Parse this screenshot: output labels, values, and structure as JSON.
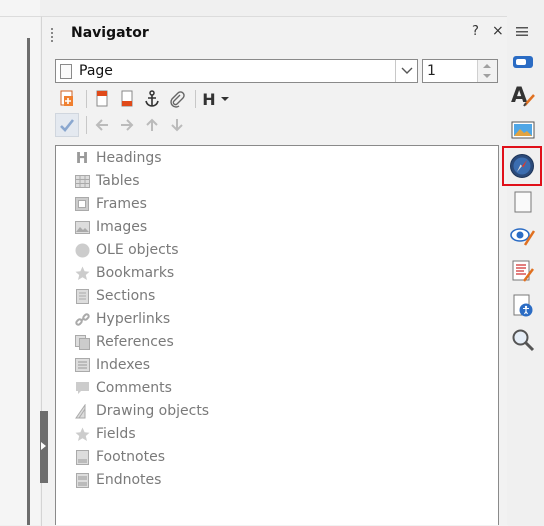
{
  "navigator": {
    "title": "Navigator",
    "help_label": "?",
    "close_label": "×",
    "navigate_by": "Page",
    "page_number": "1",
    "categories": [
      {
        "label": "Headings",
        "icon": "headings-icon"
      },
      {
        "label": "Tables",
        "icon": "tables-icon"
      },
      {
        "label": "Frames",
        "icon": "frames-icon"
      },
      {
        "label": "Images",
        "icon": "images-icon"
      },
      {
        "label": "OLE objects",
        "icon": "ole-objects-icon"
      },
      {
        "label": "Bookmarks",
        "icon": "bookmarks-icon"
      },
      {
        "label": "Sections",
        "icon": "sections-icon"
      },
      {
        "label": "Hyperlinks",
        "icon": "hyperlinks-icon"
      },
      {
        "label": "References",
        "icon": "references-icon"
      },
      {
        "label": "Indexes",
        "icon": "indexes-icon"
      },
      {
        "label": "Comments",
        "icon": "comments-icon"
      },
      {
        "label": "Drawing objects",
        "icon": "drawing-objects-icon"
      },
      {
        "label": "Fields",
        "icon": "fields-icon"
      },
      {
        "label": "Footnotes",
        "icon": "footnotes-icon"
      },
      {
        "label": "Endnotes",
        "icon": "endnotes-icon"
      }
    ],
    "heading_toolbar_label": "H"
  },
  "sidebar": {
    "tabs": [
      "properties-icon",
      "styles-icon",
      "gallery-icon",
      "navigator-icon",
      "page-icon",
      "style-inspector-icon",
      "manage-changes-icon",
      "accessibility-check-icon",
      "find-replace-icon"
    ],
    "active": "navigator-icon"
  },
  "colors": {
    "selection_border": "#e0101a",
    "item_text": "#7a7a7a",
    "accent_blue": "#2b6cc4"
  }
}
